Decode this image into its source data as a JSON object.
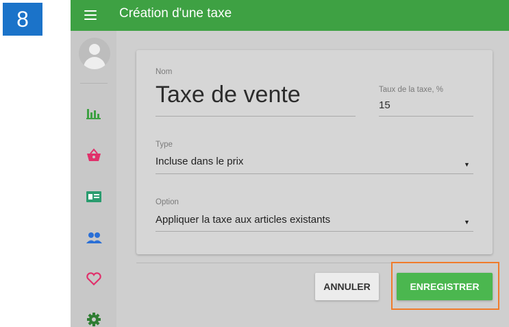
{
  "step_number": "8",
  "header": {
    "title": "Création d'une taxe",
    "menu_icon": "menu-icon"
  },
  "sidebar": {
    "avatar_icon": "avatar",
    "items": [
      {
        "icon": "bar-chart-icon",
        "color": "#3ea143"
      },
      {
        "icon": "shopping-basket-icon",
        "color": "#e0316b"
      },
      {
        "icon": "id-card-icon",
        "color": "#2a9c6f"
      },
      {
        "icon": "people-icon",
        "color": "#2a6fd6"
      },
      {
        "icon": "heart-icon",
        "color": "#e0316b"
      },
      {
        "icon": "gear-icon",
        "color": "#2f7d33"
      }
    ]
  },
  "form": {
    "name_label": "Nom",
    "name_value": "Taxe de vente",
    "rate_label": "Taux de la taxe, %",
    "rate_value": "15",
    "type_label": "Type",
    "type_value": "Incluse dans le prix",
    "option_label": "Option",
    "option_value": "Appliquer la taxe aux articles existants"
  },
  "actions": {
    "cancel_label": "ANNULER",
    "save_label": "ENREGISTRER"
  },
  "colors": {
    "topbar": "#3ea143",
    "save_button": "#4bb74f",
    "step_badge": "#1b73c9",
    "highlight": "#f07b2a"
  }
}
